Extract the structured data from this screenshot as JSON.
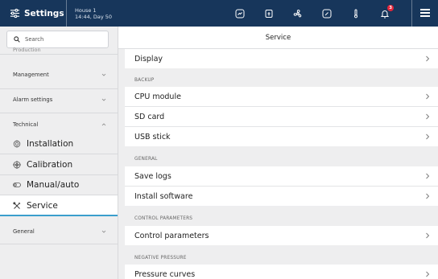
{
  "topbar": {
    "settings_label": "Settings",
    "house_name": "House 1",
    "house_time": "14:44, Day 50",
    "icons": [
      "status-icon",
      "silo-icon",
      "fan-icon",
      "gauge-icon",
      "thermometer-icon",
      "bell-icon"
    ],
    "alarm_count": "3",
    "colors": {
      "background": "#17365b",
      "badge": "#e5253a"
    }
  },
  "sidebar": {
    "search_placeholder": "Search",
    "cut_item": "Production",
    "sections": [
      {
        "label": "Management",
        "expanded": false
      },
      {
        "label": "Alarm settings",
        "expanded": false
      },
      {
        "label": "Technical",
        "expanded": true
      },
      {
        "label": "General",
        "expanded": false
      }
    ],
    "technical_items": [
      {
        "label": "Installation",
        "icon": "installation-icon"
      },
      {
        "label": "Calibration",
        "icon": "calibration-icon"
      },
      {
        "label": "Manual/auto",
        "icon": "toggle-icon"
      },
      {
        "label": "Service",
        "icon": "tools-icon",
        "active": true
      }
    ],
    "accent_color": "#3a9ecc"
  },
  "main": {
    "title": "Service",
    "display_row": "Display",
    "groups": [
      {
        "label": "BACKUP",
        "rows": [
          "CPU module",
          "SD card",
          "USB stick"
        ]
      },
      {
        "label": "GENERAL",
        "rows": [
          "Save logs",
          "Install software"
        ]
      },
      {
        "label": "CONTROL PARAMETERS",
        "rows": [
          "Control parameters"
        ]
      },
      {
        "label": "NEGATIVE PRESSURE",
        "rows": [
          "Pressure curves"
        ]
      }
    ]
  }
}
